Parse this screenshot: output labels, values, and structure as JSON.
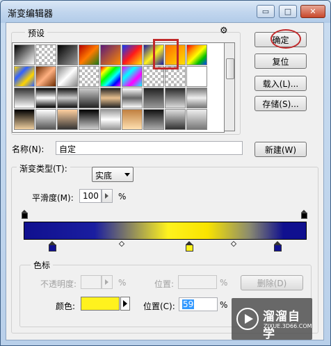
{
  "window": {
    "title": "渐变编辑器",
    "minimize_glyph": "▭",
    "maximize_glyph": "□",
    "close_glyph": "✕"
  },
  "presets": {
    "label": "预设",
    "menu_glyph": "⚙",
    "rows": [
      [
        "linear-gradient(135deg,#000,#fff)",
        "checker-bw",
        "linear-gradient(135deg,#000,#999)",
        "linear-gradient(135deg,#b30000,#ff7a00,#1a7a1a)",
        "linear-gradient(135deg,#5a1a7a,#ff8a00)",
        "linear-gradient(135deg,#0a3aff,#ff1a1a,#ffea00)",
        "linear-gradient(135deg,#1a1aa0,#fff21e,#1a1aa0)",
        "linear-gradient(135deg,#ff6a00,#ffe000)",
        "linear-gradient(135deg,#ff0000,#ff9000,#ffff00,#00c000,#0040ff)"
      ],
      [
        "linear-gradient(135deg,#ffd400,#3060ff,#ffd400,#3060ff)",
        "linear-gradient(135deg,#6a2a00,#ffb080,#6a2a00)",
        "linear-gradient(135deg,#888,#fff,#888)",
        "checker-yellow",
        "linear-gradient(135deg,#ff0000,#ffff00,#00ff00,#00ffff,#0000ff,#ff00ff)",
        "linear-gradient(135deg,#ff00ff,#00ffff,#ff00ff,#00ffff)",
        "checker-rainbow",
        "checker-plain",
        "linear-gradient(180deg,#ffffff,#ffffff)"
      ],
      [
        "linear-gradient(180deg,#333,#fff)",
        "linear-gradient(180deg,#000,#fff,#000)",
        "linear-gradient(180deg,#111,#ccc,#111)",
        "linear-gradient(180deg,#ccc,#222)",
        "linear-gradient(180deg,#222,#e8c090,#222)",
        "linear-gradient(180deg,#fff,#666,#fff)",
        "linear-gradient(180deg,#222,#999)",
        "linear-gradient(180deg,#2a2a2a,#dcdcdc)",
        "linear-gradient(180deg,#777,#eee,#777)"
      ],
      [
        "linear-gradient(180deg,#000,#f0d0a0)",
        "linear-gradient(180deg,#fff,#555)",
        "linear-gradient(180deg,#ffd0a0,#333)",
        "linear-gradient(180deg,#000,#cfcfcf)",
        "linear-gradient(180deg,#999,#fff,#999)",
        "linear-gradient(180deg,#c08040,#ffe0b0)",
        "linear-gradient(180deg,#111,#aaa)",
        "linear-gradient(180deg,#ddd,#333)",
        "linear-gradient(180deg,#eee,#777)"
      ]
    ]
  },
  "buttons": {
    "ok": "确定",
    "reset": "复位",
    "load": "载入(L)...",
    "save": "存储(S)...",
    "new": "新建(W)",
    "delete": "删除(D)"
  },
  "name_field": {
    "label": "名称(N):",
    "value": "自定"
  },
  "gradient": {
    "type_label": "渐变类型(T):",
    "type_value": "实底",
    "smoothness_label": "平滑度(M):",
    "smoothness_value": "100",
    "smoothness_unit": "%",
    "color_stops": [
      {
        "position": 10,
        "color": "#10108f"
      },
      {
        "position": 58,
        "color": "#fff21e"
      },
      {
        "position": 90,
        "color": "#10108f"
      }
    ],
    "opacity_stops": [
      {
        "position": 0
      },
      {
        "position": 100
      }
    ],
    "midpoints": [
      35,
      75
    ]
  },
  "stops": {
    "label": "色标",
    "opacity_label": "不透明度:",
    "opacity_unit": "%",
    "opacity_position_label": "位置:",
    "opacity_position_unit": "%",
    "color_label": "颜色:",
    "color_value": "#fff21e",
    "color_position_label": "位置(C):",
    "color_position_value": "59",
    "color_position_unit": "%"
  },
  "watermark": {
    "title": "溜溜自学",
    "subtitle": "ZIXUE.3D66.COM"
  },
  "colors": {
    "highlight": "#c0292a"
  }
}
